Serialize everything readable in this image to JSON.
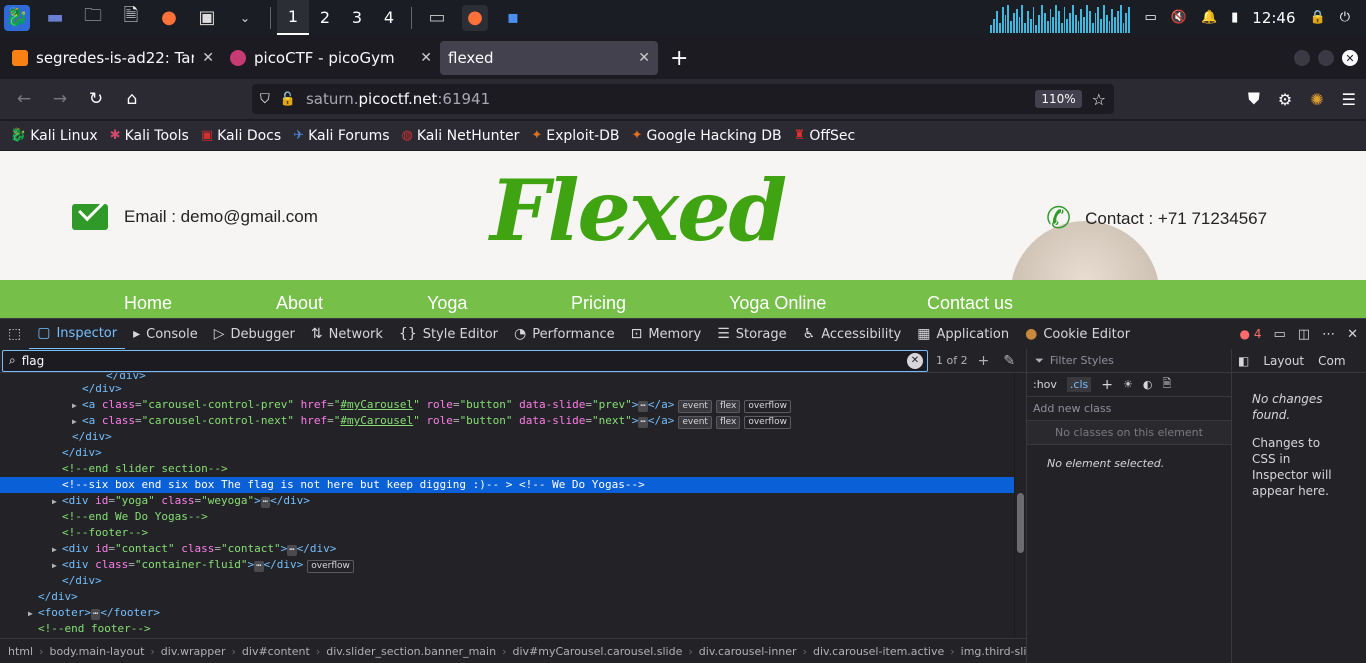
{
  "panel": {
    "workspaces": [
      "1",
      "2",
      "3",
      "4"
    ],
    "clock": "12:46"
  },
  "tabs": [
    {
      "label": "segredes-is-ad22: Tarea 5",
      "icon": "moodle-icon"
    },
    {
      "label": "picoCTF - picoGym",
      "icon": "picoctf-icon"
    },
    {
      "label": "flexed",
      "icon": "none"
    }
  ],
  "navbar": {
    "url_host": "saturn.",
    "url_domain": "picoctf.net",
    "url_port": ":61941",
    "zoom": "110%"
  },
  "bookmarks": [
    {
      "label": "Kali Linux",
      "icon": "kali-dragon-icon"
    },
    {
      "label": "Kali Tools",
      "icon": "kali-tools-icon"
    },
    {
      "label": "Kali Docs",
      "icon": "kali-docs-icon"
    },
    {
      "label": "Kali Forums",
      "icon": "kali-forums-icon"
    },
    {
      "label": "Kali NetHunter",
      "icon": "nethunter-icon"
    },
    {
      "label": "Exploit-DB",
      "icon": "exploitdb-icon"
    },
    {
      "label": "Google Hacking DB",
      "icon": "ghdb-icon"
    },
    {
      "label": "OffSec",
      "icon": "offsec-icon"
    }
  ],
  "page": {
    "email": "Email : demo@gmail.com",
    "logo": "Flexed",
    "contact": "Contact : +71 71234567",
    "menu": [
      "Home",
      "About",
      "Yoga",
      "Pricing",
      "Yoga Online",
      "Contact us"
    ]
  },
  "devtools": {
    "tabs": [
      "Inspector",
      "Console",
      "Debugger",
      "Network",
      "Style Editor",
      "Performance",
      "Memory",
      "Storage",
      "Accessibility",
      "Application",
      "Cookie Editor"
    ],
    "error_count": "4",
    "search_value": "flag",
    "match_count": "1 of 2",
    "markup": [
      "</div>",
      "</div>",
      "carousel-control-prev",
      "carousel-control-next",
      "</div>",
      "</div>",
      "<!--end slider section-->",
      "<!--six box end six box The flag is not here but keep digging :)-- > <!-- We Do Yogas-->",
      "yoga",
      "<!--end We Do Yogas-->",
      "<!--footer-->",
      "contact",
      "container-fluid",
      "</div>",
      "</div>",
      "footer",
      "<!--end footer-->"
    ],
    "breadcrumbs": [
      "html",
      "body.main-layout",
      "div.wrapper",
      "div#content",
      "div.slider_section.banner_main",
      "div#myCarousel.carousel.slide",
      "div.carousel-inner",
      "div.carousel-item.active",
      "img.third-slide"
    ],
    "rules": {
      "filter_placeholder": "Filter Styles",
      "hov": ":hov",
      "cls": ".cls",
      "add_class_placeholder": "Add new class",
      "no_classes": "No classes on this element",
      "no_element": "No element selected."
    },
    "changes": {
      "tab_layout": "Layout",
      "tab_computed": "Com",
      "no_changes": "No changes found.",
      "info": "Changes to CSS in Inspector will appear here."
    }
  }
}
